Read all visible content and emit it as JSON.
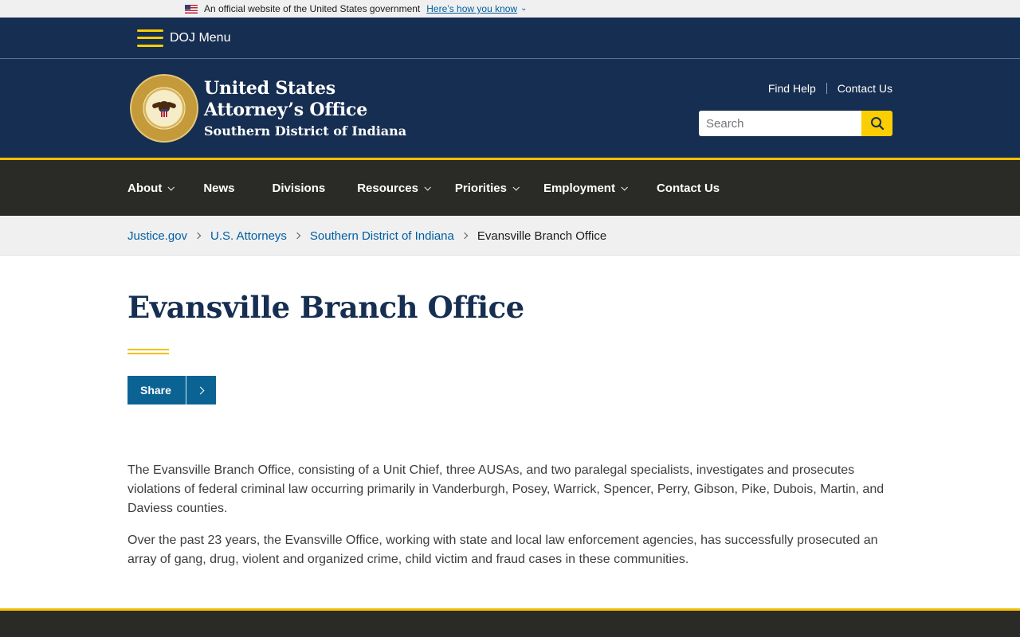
{
  "gov_banner": {
    "text": "An official website of the United States government",
    "link": "Here’s how you know"
  },
  "doj_menu": {
    "label": "DOJ Menu"
  },
  "header": {
    "title_line1": "United States",
    "title_line2": "Attorney’s Office",
    "title_line3": "Southern District of Indiana",
    "utility_links": [
      "Find Help",
      "Contact Us"
    ],
    "search_placeholder": "Search"
  },
  "nav": {
    "items": [
      {
        "label": "About",
        "dropdown": true
      },
      {
        "label": "News",
        "dropdown": false
      },
      {
        "label": "Divisions",
        "dropdown": false
      },
      {
        "label": "Resources",
        "dropdown": true
      },
      {
        "label": "Priorities",
        "dropdown": true
      },
      {
        "label": "Employment",
        "dropdown": true
      },
      {
        "label": "Contact Us",
        "dropdown": false
      }
    ]
  },
  "breadcrumb": {
    "items": [
      "Justice.gov",
      "U.S. Attorneys",
      "Southern District of Indiana"
    ],
    "current": "Evansville Branch Office"
  },
  "main": {
    "title": "Evansville Branch Office",
    "share_label": "Share",
    "paragraphs": [
      "The Evansville Branch Office, consisting of a Unit Chief, three AUSAs, and two paralegal specialists, investigates and prosecutes violations of federal criminal law occurring primarily in Vanderburgh, Posey, Warrick, Spencer, Perry, Gibson, Pike, Dubois, Martin, and Daviess counties.",
      "Over the past 23 years, the Evansville Office, working with state and local law enforcement agencies, has successfully prosecuted an array of gang, drug, violent and organized crime, child victim and fraud cases in these communities."
    ]
  },
  "colors": {
    "navy": "#162e51",
    "gold": "#face00",
    "nav_bg": "#2a2a26",
    "link": "#005ea2",
    "share_bg": "#0b6394"
  }
}
